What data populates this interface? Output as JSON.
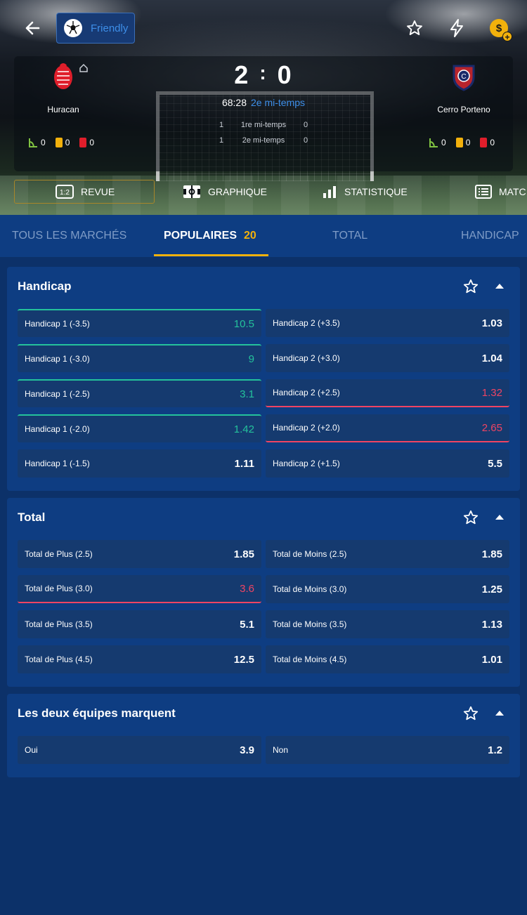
{
  "header": {
    "league": "Friendly",
    "home": {
      "name": "Huracan",
      "corners": "0",
      "yellow": "0",
      "red": "0"
    },
    "away": {
      "name": "Cerro Porteno",
      "corners": "0",
      "yellow": "0",
      "red": "0"
    },
    "score_home": "2",
    "score_sep": ":",
    "score_away": "0",
    "clock": "68:28",
    "period": "2e mi-temps",
    "halves": [
      {
        "home": "1",
        "label": "1re mi-temps",
        "away": "0"
      },
      {
        "home": "1",
        "label": "2e mi-temps",
        "away": "0"
      }
    ],
    "nav": [
      "REVUE",
      "GRAPHIQUE",
      "STATISTIQUE",
      "MATC"
    ]
  },
  "market_tabs": {
    "all": "TOUS LES MARCHÉS",
    "popular": "POPULAIRES",
    "popular_count": "20",
    "total": "TOTAL",
    "handicap": "HANDICAP"
  },
  "sections": {
    "handicap": {
      "title": "Handicap",
      "rows": [
        [
          {
            "label": "Handicap 1 (-3.5)",
            "value": "10.5"
          },
          {
            "label": "Handicap 2 (+3.5)",
            "value": "1.03"
          }
        ],
        [
          {
            "label": "Handicap 1 (-3.0)",
            "value": "9"
          },
          {
            "label": "Handicap 2 (+3.0)",
            "value": "1.04"
          }
        ],
        [
          {
            "label": "Handicap 1 (-2.5)",
            "value": "3.1"
          },
          {
            "label": "Handicap 2 (+2.5)",
            "value": "1.32"
          }
        ],
        [
          {
            "label": "Handicap 1 (-2.0)",
            "value": "1.42"
          },
          {
            "label": "Handicap 2 (+2.0)",
            "value": "2.65"
          }
        ],
        [
          {
            "label": "Handicap 1 (-1.5)",
            "value": "1.11"
          },
          {
            "label": "Handicap 2 (+1.5)",
            "value": "5.5"
          }
        ]
      ]
    },
    "total": {
      "title": "Total",
      "rows": [
        [
          {
            "label": "Total de Plus (2.5)",
            "value": "1.85"
          },
          {
            "label": "Total de Moins (2.5)",
            "value": "1.85"
          }
        ],
        [
          {
            "label": "Total de Plus (3.0)",
            "value": "3.6"
          },
          {
            "label": "Total de Moins (3.0)",
            "value": "1.25"
          }
        ],
        [
          {
            "label": "Total de Plus (3.5)",
            "value": "5.1"
          },
          {
            "label": "Total de Moins (3.5)",
            "value": "1.13"
          }
        ],
        [
          {
            "label": "Total de Plus (4.5)",
            "value": "12.5"
          },
          {
            "label": "Total de Moins (4.5)",
            "value": "1.01"
          }
        ]
      ]
    },
    "btts": {
      "title": "Les deux équipes marquent",
      "rows": [
        [
          {
            "label": "Oui",
            "value": "3.9"
          },
          {
            "label": "Non",
            "value": "1.2"
          }
        ]
      ]
    }
  },
  "colors": {
    "up": "#24c29b",
    "down": "#ef4463",
    "accent": "#f2b10c",
    "link": "#3d8ee8"
  }
}
